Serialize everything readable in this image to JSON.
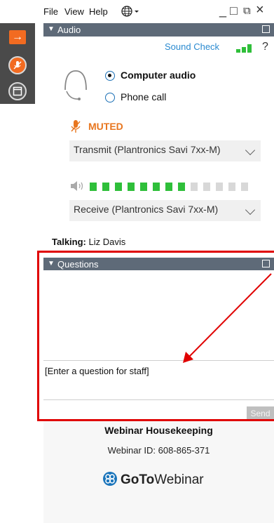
{
  "menu": {
    "file": "File",
    "view": "View",
    "help": "Help"
  },
  "window_controls": {
    "minimize": "_",
    "maximize": "□",
    "restore": "⧉",
    "close": "×"
  },
  "audio_panel": {
    "title": "Audio",
    "sound_check": "Sound Check",
    "help": "?",
    "options": [
      {
        "label": "Computer audio",
        "selected": true
      },
      {
        "label": "Phone call",
        "selected": false
      }
    ],
    "mute_status": "MUTED",
    "transmit_device": "Transmit (Plantronics Savi 7xx-M)",
    "receive_device": "Receive (Plantronics Savi 7xx-M)",
    "speaker_level_segments_on": 8,
    "speaker_level_segments_total": 13
  },
  "talking": {
    "label": "Talking:",
    "name": "Liz Davis"
  },
  "questions_panel": {
    "title": "Questions",
    "input_value": "[Enter a question for staff]",
    "send_label": "Send"
  },
  "footer": {
    "title": "Webinar Housekeeping",
    "webinar_id": "Webinar ID: 608-865-371",
    "brand_goto": "GoTo",
    "brand_webinar": "Webinar"
  },
  "colors": {
    "accent": "#f26b21",
    "header_bar": "#5e6a78",
    "meter_on": "#2fbf3a",
    "annotation": "#e00000",
    "link": "#2a8ad0"
  }
}
